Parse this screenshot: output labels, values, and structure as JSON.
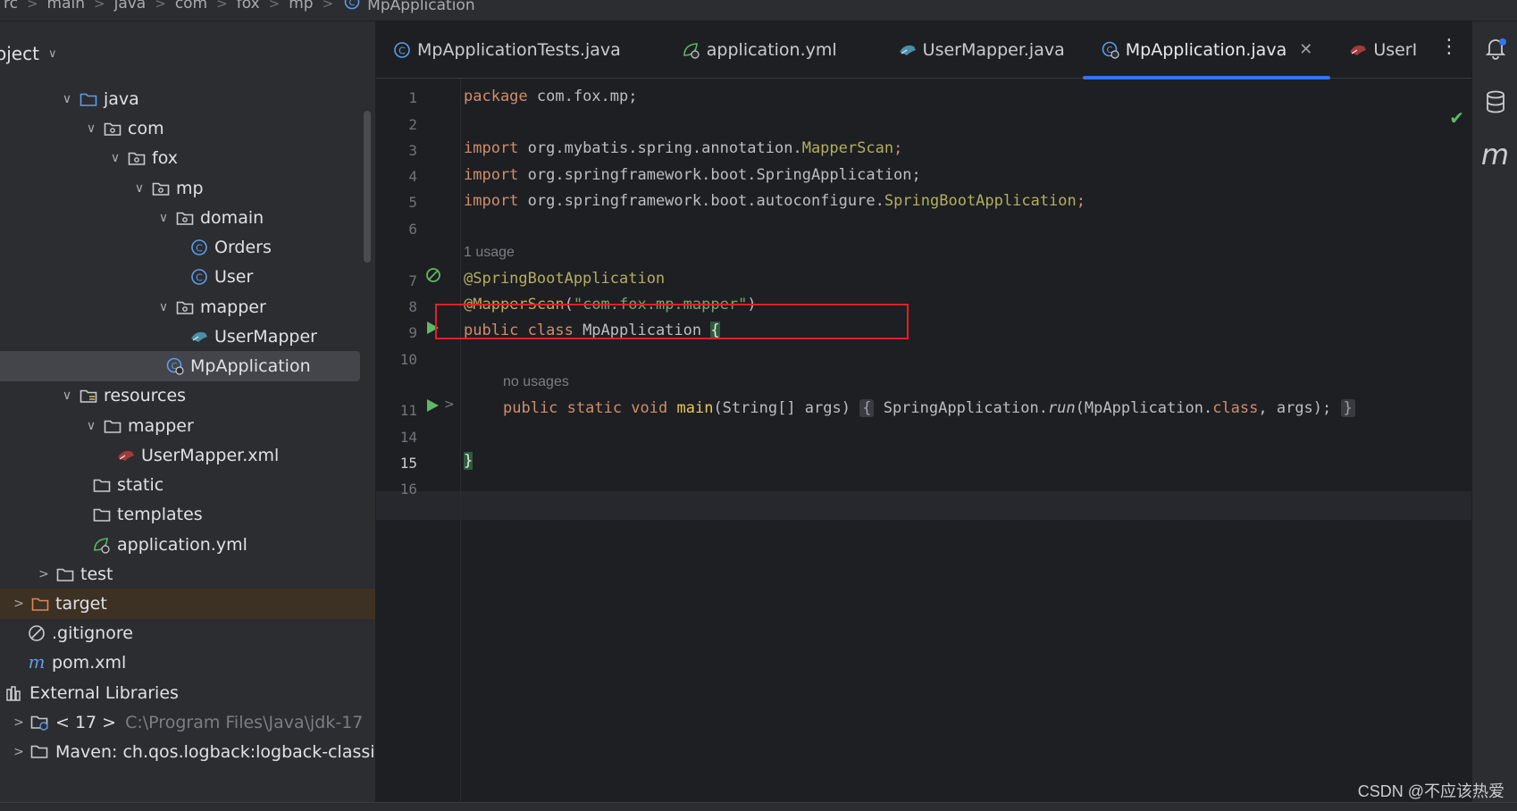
{
  "breadcrumb": [
    "rc",
    "main",
    "java",
    "com",
    "fox",
    "mp",
    "MpApplication"
  ],
  "project": {
    "title": "oject",
    "tree": [
      {
        "label": "java",
        "icon": "folder-source-icon",
        "arrow": "down"
      },
      {
        "label": "com",
        "icon": "package-icon",
        "arrow": "down"
      },
      {
        "label": "fox",
        "icon": "package-icon",
        "arrow": "down"
      },
      {
        "label": "mp",
        "icon": "package-icon",
        "arrow": "down"
      },
      {
        "label": "domain",
        "icon": "package-icon",
        "arrow": "down"
      },
      {
        "label": "Orders",
        "icon": "class-icon",
        "arrow": "none"
      },
      {
        "label": "User",
        "icon": "class-icon",
        "arrow": "none"
      },
      {
        "label": "mapper",
        "icon": "package-icon",
        "arrow": "down"
      },
      {
        "label": "UserMapper",
        "icon": "mybatis-mapper-icon",
        "arrow": "none"
      },
      {
        "label": "MpApplication",
        "icon": "spring-boot-class-icon",
        "arrow": "none"
      },
      {
        "label": "resources",
        "icon": "resources-folder-icon",
        "arrow": "down"
      },
      {
        "label": "mapper",
        "icon": "folder-icon",
        "arrow": "down"
      },
      {
        "label": "UserMapper.xml",
        "icon": "mybatis-xml-icon",
        "arrow": "none"
      },
      {
        "label": "static",
        "icon": "folder-icon",
        "arrow": "none"
      },
      {
        "label": "templates",
        "icon": "folder-icon",
        "arrow": "none"
      },
      {
        "label": "application.yml",
        "icon": "spring-yml-icon",
        "arrow": "none"
      },
      {
        "label": "test",
        "icon": "folder-icon",
        "arrow": "right"
      },
      {
        "label": "target",
        "icon": "target-folder-icon",
        "arrow": "right"
      },
      {
        "label": ".gitignore",
        "icon": "ignore-icon",
        "arrow": "none"
      },
      {
        "label": "pom.xml",
        "icon": "maven-icon",
        "arrow": "none"
      },
      {
        "label": "External Libraries",
        "icon": "library-icon",
        "arrow": "none"
      },
      {
        "label": "< 17 >",
        "extra": "C:\\Program Files\\Java\\jdk-17",
        "icon": "jdk-icon",
        "arrow": "right"
      },
      {
        "label": "Maven: ch.qos.logback:logback-classic",
        "icon": "library-jar-icon",
        "arrow": "right"
      }
    ]
  },
  "tabs": [
    {
      "label": "MpApplicationTests.java",
      "icon": "class-icon"
    },
    {
      "label": "application.yml",
      "icon": "spring-yml-icon"
    },
    {
      "label": "UserMapper.java",
      "icon": "mybatis-mapper-icon"
    },
    {
      "label": "MpApplication.java",
      "icon": "spring-boot-class-icon",
      "active": true
    },
    {
      "label": "UserI",
      "icon": "mybatis-xml-icon"
    }
  ],
  "editor": {
    "line_numbers": [
      "1",
      "2",
      "3",
      "4",
      "5",
      "6",
      "7",
      "8",
      "9",
      "10",
      "11",
      "14",
      "15",
      "16"
    ],
    "hint_usage": "1 usage",
    "hint_no_usages": "no usages",
    "code": {
      "l1_kw": "package",
      "l1_rest": " com.fox.mp;",
      "l3_kw": "import",
      "l3_pkg": " org.mybatis.spring.annotation.",
      "l3_cls": "MapperScan",
      "l3_end": ";",
      "l4_kw": "import",
      "l4_pkg": " org.springframework.boot.SpringApplication;",
      "l5_kw": "import",
      "l5_pkg": " org.springframework.boot.autoconfigure.",
      "l5_cls": "SpringBootApplication",
      "l5_end": ";",
      "l7_ann": "@SpringBootApplication",
      "l8_ann": "@MapperScan",
      "l8_open": "(",
      "l8_str": "\"com.fox.mp.mapper\"",
      "l8_close": ")",
      "l9_kw": "public class",
      "l9_name": " MpApplication ",
      "l9_brace": "{",
      "l11_kw": "public static void",
      "l11_fn": "main",
      "l11_params": "(String[] args)",
      "l11_fold_open": "{",
      "l11_body1": " SpringApplication.",
      "l11_run": "run",
      "l11_body2": "(MpApplication.",
      "l11_class": "class",
      "l11_body3": ", args);",
      "l11_fold_close": "}",
      "l15_brace": "}"
    }
  },
  "watermark": "CSDN @不应该热爱"
}
